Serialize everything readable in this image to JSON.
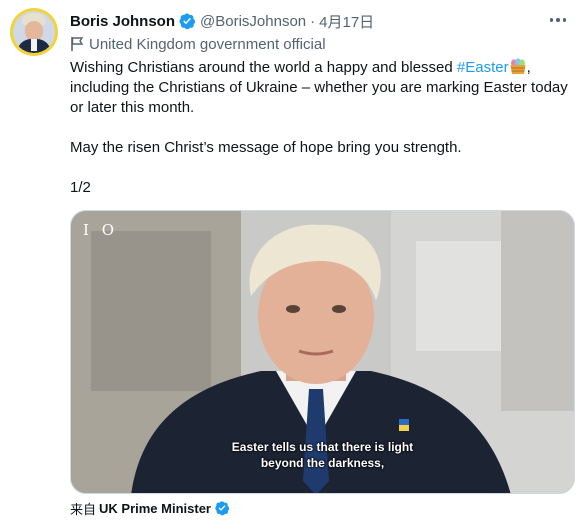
{
  "author": {
    "name": "Boris Johnson",
    "handle": "@BorisJohnson",
    "separator": "·",
    "date": "4月17日",
    "label": "United Kingdom government official"
  },
  "tweet": {
    "line1_pre": "Wishing Christians around the world a happy and blessed ",
    "hashtag": "#Easter",
    "line1_post": ",",
    "line2": "including the Christians of Ukraine – whether you are marking Easter today",
    "line3": "or later this month.",
    "line4": "May the risen Christ’s message of hope bring you strength.",
    "line5": "1/2"
  },
  "media": {
    "logo_text": "I O",
    "caption_line1": "Easter tells us that there is light",
    "caption_line2": "beyond the darkness,"
  },
  "source": {
    "from_label": "来自",
    "name": "UK Prime Minister"
  },
  "colors": {
    "link": "#1d9bf0",
    "verified": "#1d9bf0",
    "secondary_text": "#536471"
  },
  "icons": [
    "verified-badge-icon",
    "more-options-icon",
    "government-flag-icon",
    "easter-basket-emoji"
  ]
}
